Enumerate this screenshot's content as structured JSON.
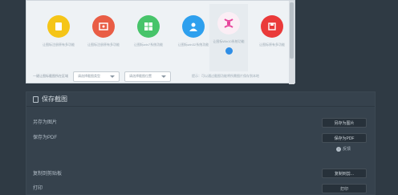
{
  "preview": {
    "icons": [
      {
        "name": "yellow-doc-icon",
        "color": "#f5c518",
        "caption": "让图标注册原有多功能"
      },
      {
        "name": "red-picture-icon",
        "color": "#e95d45",
        "caption": "让图标注册原有多功能"
      },
      {
        "name": "windows-icon",
        "color": "#47c46a",
        "caption": "让图标win7系统功能"
      },
      {
        "name": "blue-person-icon",
        "color": "#2ea0ee",
        "caption": "让图标win32系统功能"
      },
      {
        "name": "pink-screenshot-icon",
        "color": "#e7449b",
        "caption": "让图标Win10系统功能"
      },
      {
        "name": "red-save-icon",
        "color": "#ea3a3a",
        "caption": "让图标原有多功能"
      }
    ],
    "controls": {
      "label": "一键让图标截图所在区域",
      "select1": "请选择截图类型",
      "select2": "请选择截图位置",
      "hint": "提示：可以通过截图功能将所需图片保存到本地"
    }
  },
  "panel": {
    "title": "保存截图",
    "rows": {
      "save_image": "另存为图片",
      "save_pdf": "保存为PDF",
      "copy_clipboard": "复制到剪贴板",
      "print": "打印"
    },
    "buttons": {
      "save_image": "另存为图片",
      "save_pdf": "保存为PDF",
      "copy_clipboard": "复制到剪...",
      "print": "打印"
    },
    "feedback": "反馈"
  }
}
